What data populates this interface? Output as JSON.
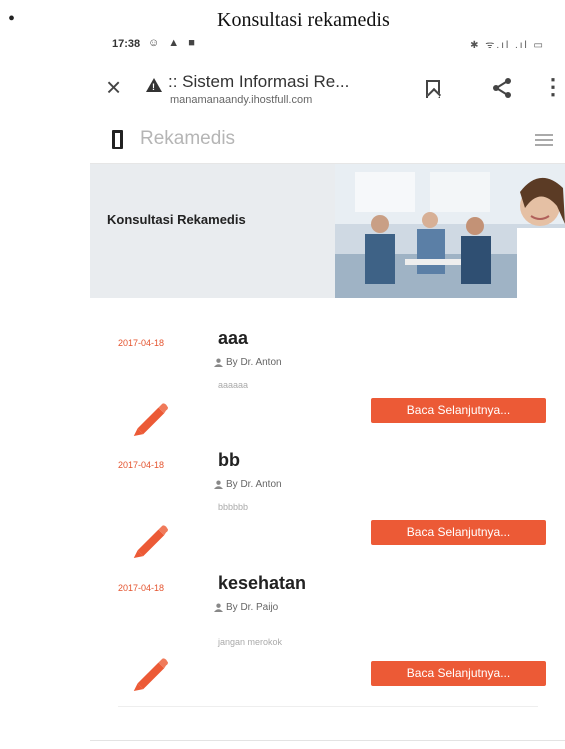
{
  "caption": {
    "bullet": "•",
    "text": "Konsultasi rekamedis"
  },
  "status_bar": {
    "time": "17:38",
    "left_icons": "☺ ▲ ■",
    "right_icons": "✱ ᯤ.ıl .ıl ▭"
  },
  "browser": {
    "title": ":: Sistem Informasi Re...",
    "url": "manamanaandy.ihostfull.com",
    "warning_mark": "!"
  },
  "site": {
    "brand": "Rekamedis"
  },
  "hero": {
    "title": "Konsultasi Rekamedis"
  },
  "posts": [
    {
      "date": "2017-04-18",
      "title": "aaa",
      "author": "By Dr. Anton",
      "excerpt": "aaaaaa",
      "read_more": "Baca Selanjutnya..."
    },
    {
      "date": "2017-04-18",
      "title": "bb",
      "author": "By Dr. Anton",
      "excerpt": "bbbbbb",
      "read_more": "Baca Selanjutnya..."
    },
    {
      "date": "2017-04-18",
      "title": "kesehatan",
      "author": "By Dr. Paijo",
      "excerpt": "jangan merokok",
      "read_more": "Baca Selanjutnya..."
    }
  ],
  "colors": {
    "accent": "#ec5a36",
    "date": "#e4542f",
    "hero_bg": "#e9ecef"
  }
}
